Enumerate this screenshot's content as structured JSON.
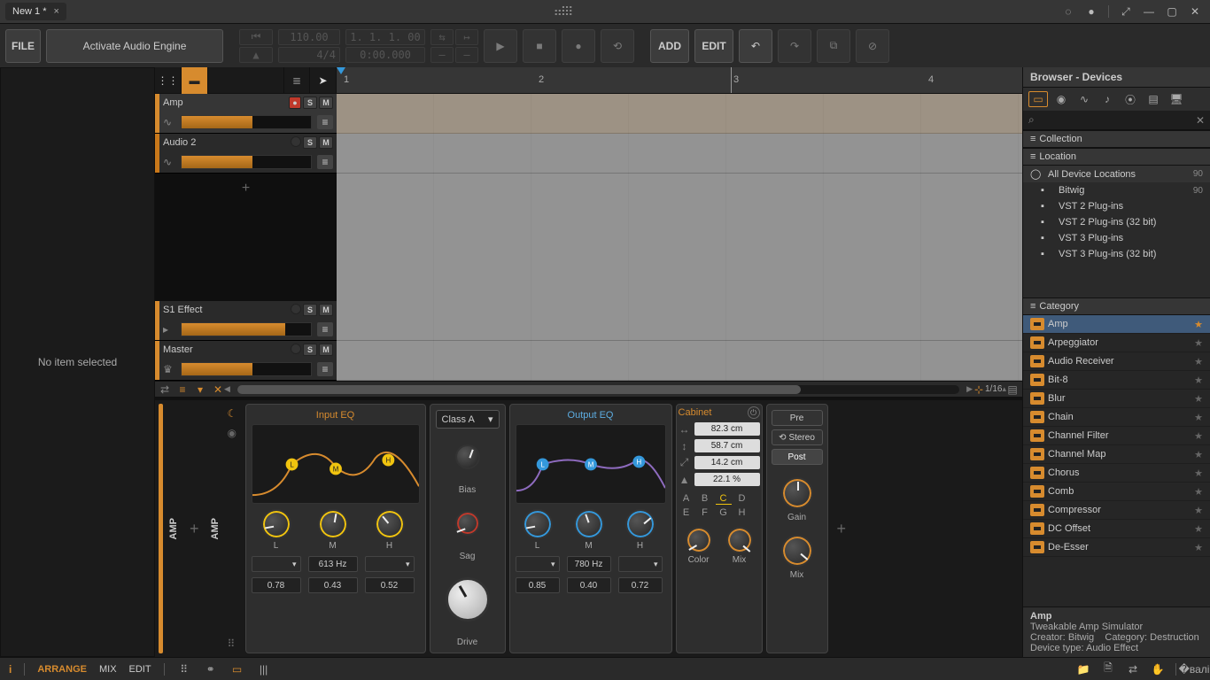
{
  "window": {
    "tab_title": "New 1 *"
  },
  "toolbar": {
    "file": "FILE",
    "activate": "Activate Audio Engine",
    "tempo": "110.00",
    "timesig": "4/4",
    "pos_bars": "1. 1. 1. 00",
    "pos_time": "0:00.000",
    "add": "ADD",
    "edit": "EDIT"
  },
  "left_panel": {
    "empty": "No item selected"
  },
  "ruler_marks": [
    "1",
    "2",
    "3",
    "4"
  ],
  "tracks": [
    {
      "name": "Amp",
      "accent": "#d78b2e",
      "rec": true,
      "fill": 55,
      "sel": true
    },
    {
      "name": "Audio 2",
      "accent": "#c9781a",
      "rec": false,
      "fill": 55,
      "sel": false
    }
  ],
  "bus_tracks": [
    {
      "name": "S1 Effect",
      "accent": "#d78b2e",
      "fill": 80
    },
    {
      "name": "Master",
      "accent": "#d78b2e",
      "fill": 55
    }
  ],
  "arr_zoom": "1/16",
  "device": {
    "name": "AMP",
    "input_eq": {
      "title": "Input EQ",
      "bands": [
        "L",
        "M",
        "H"
      ],
      "freq_center": "613 Hz",
      "vals": [
        "0.78",
        "0.43",
        "0.52"
      ]
    },
    "amp_class": {
      "selected": "Class A",
      "bias_label": "Bias",
      "sag_label": "Sag",
      "drive_label": "Drive"
    },
    "output_eq": {
      "title": "Output EQ",
      "bands": [
        "L",
        "M",
        "H"
      ],
      "freq_center": "780 Hz",
      "vals": [
        "0.85",
        "0.40",
        "0.72"
      ]
    },
    "cabinet": {
      "title": "Cabinet",
      "width": "82.3 cm",
      "height": "58.7 cm",
      "depth": "14.2 cm",
      "thickness": "22.1 %",
      "letters": [
        "A",
        "B",
        "C",
        "D",
        "E",
        "F",
        "G",
        "H"
      ],
      "sel_letter": "C",
      "color_label": "Color",
      "mix_label": "Mix"
    },
    "output": {
      "pre": "Pre",
      "stereo": "Stereo",
      "post": "Post",
      "gain_label": "Gain",
      "mix_label": "Mix"
    }
  },
  "browser": {
    "title": "Browser - Devices",
    "search_placeholder": "",
    "collection_hdr": "Collection",
    "location_hdr": "Location",
    "all_locations": "All Device Locations",
    "all_count": "90",
    "locations": [
      {
        "label": "Bitwig",
        "badge": "90"
      },
      {
        "label": "VST 2 Plug-ins",
        "badge": ""
      },
      {
        "label": "VST 2 Plug-ins (32 bit)",
        "badge": ""
      },
      {
        "label": "VST 3 Plug-ins",
        "badge": ""
      },
      {
        "label": "VST 3 Plug-ins (32 bit)",
        "badge": ""
      }
    ],
    "category_hdr": "Category",
    "categories": [
      "Amp",
      "Arpeggiator",
      "Audio Receiver",
      "Bit-8",
      "Blur",
      "Chain",
      "Channel Filter",
      "Channel Map",
      "Chorus",
      "Comb",
      "Compressor",
      "DC Offset",
      "De-Esser"
    ],
    "info": {
      "name": "Amp",
      "desc": "Tweakable Amp Simulator",
      "creator_lbl": "Creator:",
      "creator": "Bitwig",
      "cat_lbl": "Category:",
      "cat": "Destruction",
      "type_lbl": "Device type:",
      "type": "Audio Effect"
    }
  },
  "bottom": {
    "views": [
      "ARRANGE",
      "MIX",
      "EDIT"
    ]
  }
}
